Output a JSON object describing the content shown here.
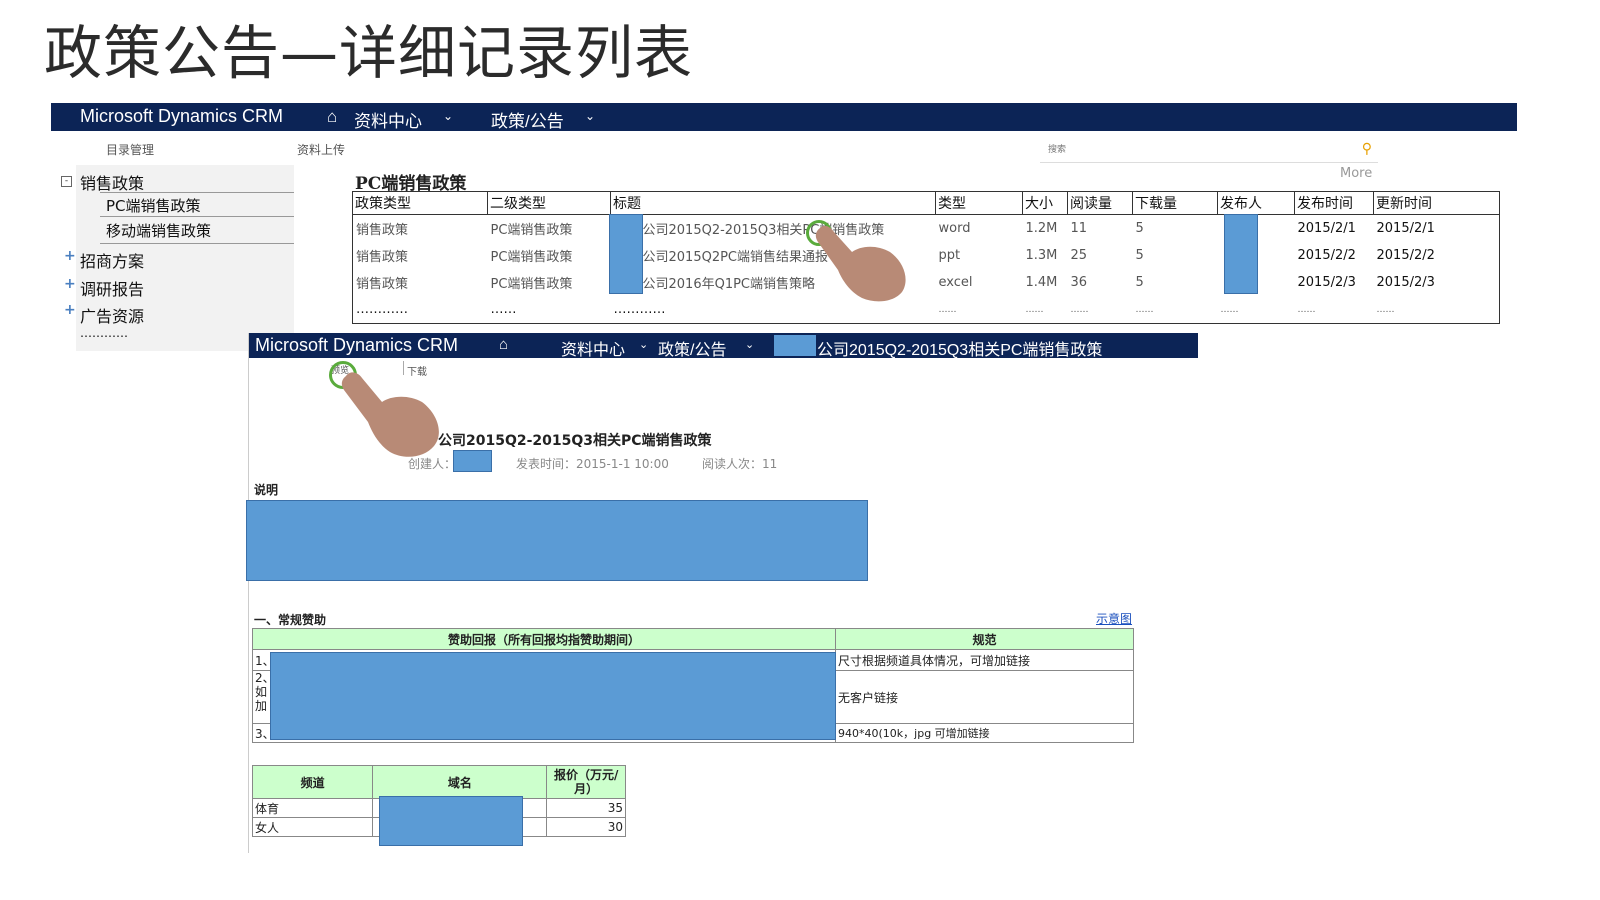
{
  "slide_title": "政策公告—详细记录列表",
  "top_nav": {
    "brand": "Microsoft Dynamics CRM",
    "menu1": "资料中心",
    "menu2": "政策/公告"
  },
  "subnav": {
    "catalog": "目录管理",
    "upload": "资料上传",
    "search_placeholder": "搜索",
    "more": "More"
  },
  "tree": {
    "root": "销售政策",
    "children": [
      "PC端销售政策",
      "移动端销售政策"
    ],
    "others": [
      "招商方案",
      "调研报告",
      "广告资源"
    ],
    "ellipsis": "…………"
  },
  "list": {
    "title": "PC端销售政策",
    "columns": [
      "政策类型",
      "二级类型",
      "标题",
      "类型",
      "大小",
      "阅读量",
      "下载量",
      "发布人",
      "发布时间",
      "更新时间"
    ],
    "rows": [
      [
        "销售政策",
        "PC端销售政策",
        "公司2015Q2-2015Q3相关PC端销售政策",
        "word",
        "1.2M",
        "11",
        "5",
        "",
        "2015/2/1",
        "2015/2/1"
      ],
      [
        "销售政策",
        "PC端销售政策",
        "公司2015Q2PC端销售结果通报",
        "ppt",
        "1.3M",
        "25",
        "5",
        "",
        "2015/2/2",
        "2015/2/2"
      ],
      [
        "销售政策",
        "PC端销售政策",
        "公司2016年Q1PC端销售策略",
        "excel",
        "1.4M",
        "36",
        "5",
        "",
        "2015/2/3",
        "2015/2/3"
      ],
      [
        "…………",
        "……",
        "…………",
        "……",
        "……",
        "……",
        "……",
        "……",
        "……",
        "……"
      ]
    ]
  },
  "detail": {
    "nav_brand": "Microsoft Dynamics CRM",
    "nav_menu1": "资料中心",
    "nav_menu2": "政策/公告",
    "nav_breadcrumb": "公司2015Q2-2015Q3相关PC端销售政策",
    "action_view": "预览",
    "action_download": "下载",
    "doc_title": "公司2015Q2-2015Q3相关PC端销售政策",
    "creator_label": "创建人：",
    "publish_time": "发表时间：2015-1-1 10:00",
    "read_count": "阅读人次：11",
    "desc_label": "说明",
    "section_title": "一、常规赞助",
    "diagram_link": "示意图",
    "sponsor_table": {
      "header_left": "赞助回报（所有回报均指赞助期间）",
      "header_right": "规范",
      "row_labels": [
        "1、",
        "2、",
        "如",
        "加",
        "3、"
      ],
      "specs": [
        "尺寸根据频道具体情况，可增加链接",
        "无客户链接",
        "940*40(10k，jpg 可增加链接"
      ]
    },
    "price_table": {
      "headers": [
        "频道",
        "域名",
        "报价（万元/月）"
      ],
      "rows": [
        [
          "体育",
          "",
          "35"
        ],
        [
          "女人",
          "",
          "30"
        ]
      ]
    }
  },
  "colors": {
    "nav_bg": "#0c2456",
    "redaction": "#5b9bd5",
    "green_header": "#ccffcc",
    "ring": "#5aab3c",
    "hand": "#b88a76"
  }
}
